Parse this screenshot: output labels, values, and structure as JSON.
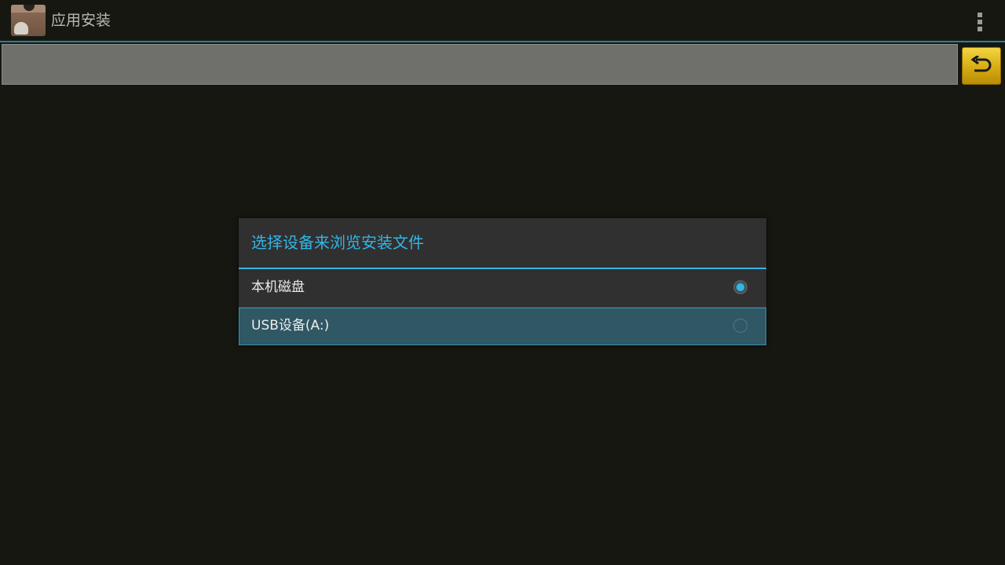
{
  "action_bar": {
    "title": "应用安装",
    "app_icon": "package-app-icon",
    "overflow_icon": "overflow-menu-icon"
  },
  "path_bar": {
    "current_path": "",
    "back_icon": "return-arrow-icon"
  },
  "dialog": {
    "title": "选择设备来浏览安装文件",
    "options": [
      {
        "label": "本机磁盘",
        "selected": true
      },
      {
        "label": "USB设备(A:)",
        "selected": false
      }
    ]
  },
  "colors": {
    "accent": "#33b5e5",
    "background": "#171712",
    "dialog": "#303030",
    "back_button": "#e0b820"
  }
}
